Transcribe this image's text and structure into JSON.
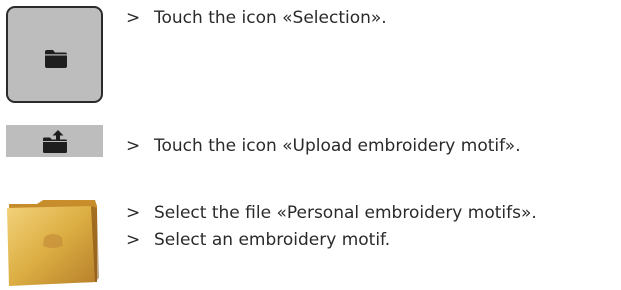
{
  "steps": [
    {
      "icon": "folder-icon",
      "marker": ">",
      "text": "Touch the icon «Selection»."
    },
    {
      "icon": "folder-upload-icon",
      "marker": ">",
      "text": "Touch the icon «Upload embroidery motif»."
    },
    {
      "icon": "personal-folder-icon",
      "marker": ">",
      "text": "Select the file «Personal embroidery motifs»."
    },
    {
      "marker": ">",
      "text": "Select an embroidery motif."
    }
  ],
  "colors": {
    "tile_gray": "#bdbdbd",
    "tile_border": "#2b2b2b",
    "icon_dark": "#1e1e1e",
    "folder_gold": "#d9a93c",
    "text": "#2a2a2a"
  }
}
